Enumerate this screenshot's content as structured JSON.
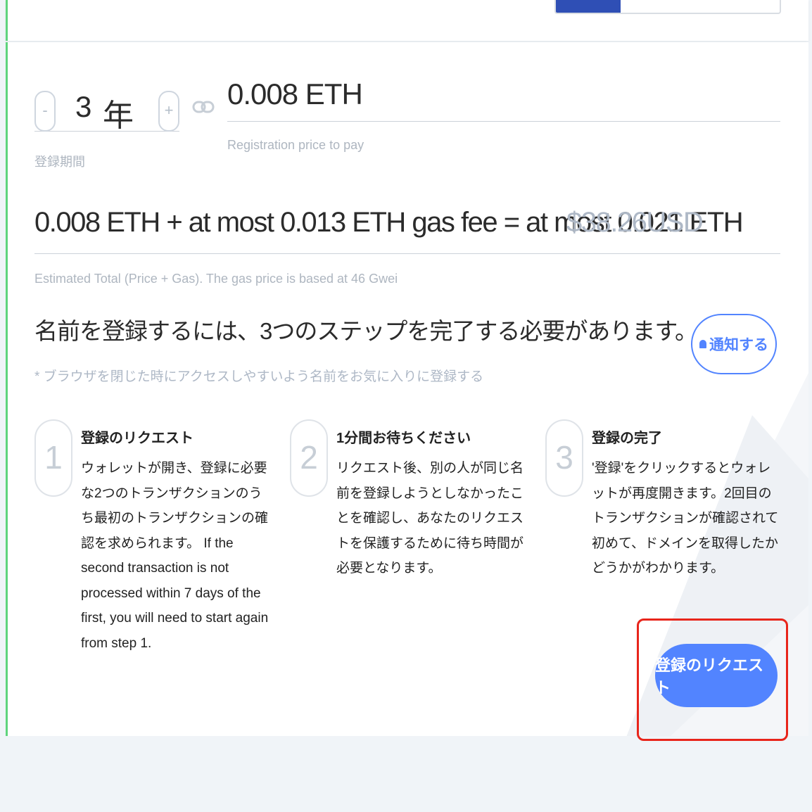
{
  "duration": {
    "minus": "-",
    "value": "3",
    "unit": "年",
    "plus": "+",
    "label": "登録期間"
  },
  "price": {
    "value": "0.008 ETH",
    "label": "Registration price to pay"
  },
  "total": {
    "formula": "0.008 ETH + at most 0.013 ETH gas fee = at most 0.021 ETH",
    "usd": "$38.26USD",
    "label": "Estimated Total (Price + Gas). The gas price is based at 46 Gwei"
  },
  "steps_section": {
    "heading": "名前を登録するには、3つのステップを完了する必要があります。",
    "hint": "* ブラウザを閉じた時にアクセスしやすいよう名前をお気に入りに登録する",
    "notify_label": "通知する"
  },
  "steps": [
    {
      "number": "1",
      "title": "登録のリクエスト",
      "desc": "ウォレットが開き、登録に必要な2つのトランザクションのうち最初のトランザクションの確認を求められます。 If the second transaction is not processed within 7 days of the first, you will need to start again from step 1."
    },
    {
      "number": "2",
      "title": "1分間お待ちください",
      "desc": "リクエスト後、別の人が同じ名前を登録しようとしなかったことを確認し、あなたのリクエストを保護するために待ち時間が必要となります。"
    },
    {
      "number": "3",
      "title": "登録の完了",
      "desc": "'登録'をクリックするとウォレットが再度開きます。2回目のトランザクションが確認されて初めて、ドメインを取得したかどうかがわかります。"
    }
  ],
  "request_button": "登録のリクエスト",
  "colors": {
    "accent": "#5284ff",
    "success_border": "#5fd47d",
    "highlight": "#e8251b"
  }
}
